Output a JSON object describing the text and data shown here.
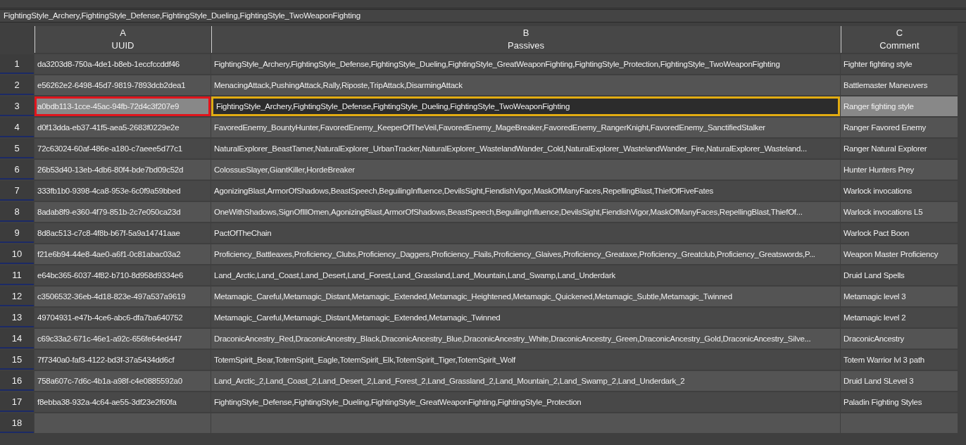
{
  "formula_bar": {
    "value": "FightingStyle_Archery,FightingStyle_Defense,FightingStyle_Dueling,FightingStyle_TwoWeaponFighting"
  },
  "table": {
    "columns": [
      {
        "letter": "A",
        "name": "UUID"
      },
      {
        "letter": "B",
        "name": "Passives"
      },
      {
        "letter": "C",
        "name": "Comment"
      }
    ],
    "rows": [
      {
        "number": "1",
        "selected": false,
        "editing": false,
        "outlined": false,
        "uuid": "da3203d8-750a-4de1-b8eb-1eccfccddf46",
        "passives": "FightingStyle_Archery,FightingStyle_Defense,FightingStyle_Dueling,FightingStyle_GreatWeaponFighting,FightingStyle_Protection,FightingStyle_TwoWeaponFighting",
        "comment": "Fighter fighting style"
      },
      {
        "number": "2",
        "selected": false,
        "editing": false,
        "outlined": false,
        "uuid": "e56262e2-6498-45d7-9819-7893dcb2dea1",
        "passives": "MenacingAttack,PushingAttack,Rally,Riposte,TripAttack,DisarmingAttack",
        "comment": "Battlemaster Maneuvers"
      },
      {
        "number": "3",
        "selected": true,
        "editing": true,
        "outlined": true,
        "uuid": "a0bdb113-1cce-45ac-94fb-72d4c3f207e9",
        "passives": "FightingStyle_Archery,FightingStyle_Defense,FightingStyle_Dueling,FightingStyle_TwoWeaponFighting",
        "comment": "Ranger fighting style"
      },
      {
        "number": "4",
        "selected": false,
        "editing": false,
        "outlined": false,
        "uuid": "d0f13dda-eb37-41f5-aea5-2683f0229e2e",
        "passives": "FavoredEnemy_BountyHunter,FavoredEnemy_KeeperOfTheVeil,FavoredEnemy_MageBreaker,FavoredEnemy_RangerKnight,FavoredEnemy_SanctifiedStalker",
        "comment": "Ranger Favored Enemy"
      },
      {
        "number": "5",
        "selected": false,
        "editing": false,
        "outlined": false,
        "uuid": "72c63024-60af-486e-a180-c7aeee5d77c1",
        "passives": "NaturalExplorer_BeastTamer,NaturalExplorer_UrbanTracker,NaturalExplorer_WastelandWander_Cold,NaturalExplorer_WastelandWander_Fire,NaturalExplorer_Wasteland...",
        "comment": "Ranger Natural Explorer"
      },
      {
        "number": "6",
        "selected": false,
        "editing": false,
        "outlined": false,
        "uuid": "26b53d40-13eb-4db6-80f4-bde7bd09c52d",
        "passives": "ColossusSlayer,GiantKiller,HordeBreaker",
        "comment": "Hunter Hunters Prey"
      },
      {
        "number": "7",
        "selected": false,
        "editing": false,
        "outlined": false,
        "uuid": "333fb1b0-9398-4ca8-953e-6c0f9a59bbed",
        "passives": "AgonizingBlast,ArmorOfShadows,BeastSpeech,BeguilingInfluence,DevilsSight,FiendishVigor,MaskOfManyFaces,RepellingBlast,ThiefOfFiveFates",
        "comment": "Warlock invocations"
      },
      {
        "number": "8",
        "selected": false,
        "editing": false,
        "outlined": false,
        "uuid": "8adab8f9-e360-4f79-851b-2c7e050ca23d",
        "passives": "OneWithShadows,SignOfIllOmen,AgonizingBlast,ArmorOfShadows,BeastSpeech,BeguilingInfluence,DevilsSight,FiendishVigor,MaskOfManyFaces,RepellingBlast,ThiefOf...",
        "comment": "Warlock invocations L5"
      },
      {
        "number": "9",
        "selected": false,
        "editing": false,
        "outlined": false,
        "uuid": "8d8ac513-c7c8-4f8b-b67f-5a9a14741aae",
        "passives": "PactOfTheChain",
        "comment": "Warlock Pact Boon"
      },
      {
        "number": "10",
        "selected": false,
        "editing": false,
        "outlined": false,
        "uuid": "f21e6b94-44e8-4ae0-a6f1-0c81abac03a2",
        "passives": "Proficiency_Battleaxes,Proficiency_Clubs,Proficiency_Daggers,Proficiency_Flails,Proficiency_Glaives,Proficiency_Greataxe,Proficiency_Greatclub,Proficiency_Greatswords,P...",
        "comment": "Weapon Master Proficiency"
      },
      {
        "number": "11",
        "selected": false,
        "editing": false,
        "outlined": false,
        "uuid": "e64bc365-6037-4f82-b710-8d958d9334e6",
        "passives": "Land_Arctic,Land_Coast,Land_Desert,Land_Forest,Land_Grassland,Land_Mountain,Land_Swamp,Land_Underdark",
        "comment": "Druid Land Spells"
      },
      {
        "number": "12",
        "selected": false,
        "editing": false,
        "outlined": false,
        "uuid": "c3506532-36eb-4d18-823e-497a537a9619",
        "passives": "Metamagic_Careful,Metamagic_Distant,Metamagic_Extended,Metamagic_Heightened,Metamagic_Quickened,Metamagic_Subtle,Metamagic_Twinned",
        "comment": "Metamagic level 3"
      },
      {
        "number": "13",
        "selected": false,
        "editing": false,
        "outlined": false,
        "uuid": "49704931-e47b-4ce6-abc6-dfa7ba640752",
        "passives": "Metamagic_Careful,Metamagic_Distant,Metamagic_Extended,Metamagic_Twinned",
        "comment": "Metamagic level 2"
      },
      {
        "number": "14",
        "selected": false,
        "editing": false,
        "outlined": false,
        "uuid": "c69c33a2-671c-46e1-a92c-656fe64ed447",
        "passives": "DraconicAncestry_Red,DraconicAncestry_Black,DraconicAncestry_Blue,DraconicAncestry_White,DraconicAncestry_Green,DraconicAncestry_Gold,DraconicAncestry_Silve...",
        "comment": "DraconicAncestry"
      },
      {
        "number": "15",
        "selected": false,
        "editing": false,
        "outlined": false,
        "uuid": "7f7340a0-faf3-4122-bd3f-37a5434dd6cf",
        "passives": "TotemSpirit_Bear,TotemSpirit_Eagle,TotemSpirit_Elk,TotemSpirit_Tiger,TotemSpirit_Wolf",
        "comment": "Totem Warrior lvl 3 path"
      },
      {
        "number": "16",
        "selected": false,
        "editing": false,
        "outlined": false,
        "uuid": "758a607c-7d6c-4b1a-a98f-c4e0885592a0",
        "passives": "Land_Arctic_2,Land_Coast_2,Land_Desert_2,Land_Forest_2,Land_Grassland_2,Land_Mountain_2,Land_Swamp_2,Land_Underdark_2",
        "comment": "Druid Land SLevel 3"
      },
      {
        "number": "17",
        "selected": false,
        "editing": false,
        "outlined": false,
        "uuid": "f8ebba38-932a-4c64-ae55-3df23e2f60fa",
        "passives": "FightingStyle_Defense,FightingStyle_Dueling,FightingStyle_GreatWeaponFighting,FightingStyle_Protection",
        "comment": "Paladin Fighting Styles"
      },
      {
        "number": "18",
        "selected": false,
        "editing": false,
        "outlined": false
      }
    ]
  }
}
